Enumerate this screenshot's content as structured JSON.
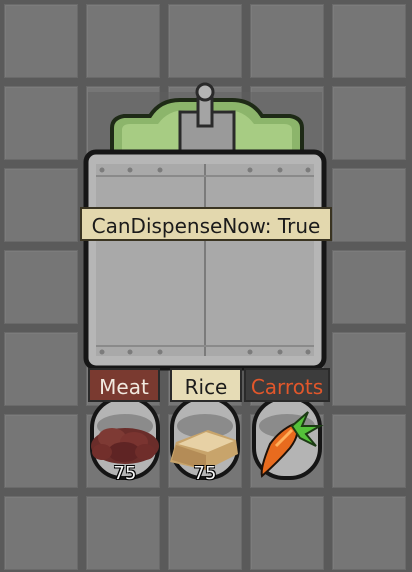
{
  "dispenser": {
    "status_text": "CanDispenseNow: True"
  },
  "ingredients": [
    {
      "label": "Meat",
      "count": "75",
      "icon": "meat-icon"
    },
    {
      "label": "Rice",
      "count": "75",
      "icon": "rice-icon"
    },
    {
      "label": "Carrots",
      "count": "",
      "icon": "carrot-icon"
    }
  ],
  "colors": {
    "floor": "#767676",
    "grid_line": "#5e5e5e",
    "machine_body": "#b7b7b7",
    "machine_top": "#8fb86e",
    "status_bg": "#e3d8ae",
    "meat_label_bg": "#7a3a30",
    "rice_label_bg": "#e6dcb6",
    "carrots_label_bg": "#3c3c3c",
    "carrots_text": "#e2572b"
  }
}
